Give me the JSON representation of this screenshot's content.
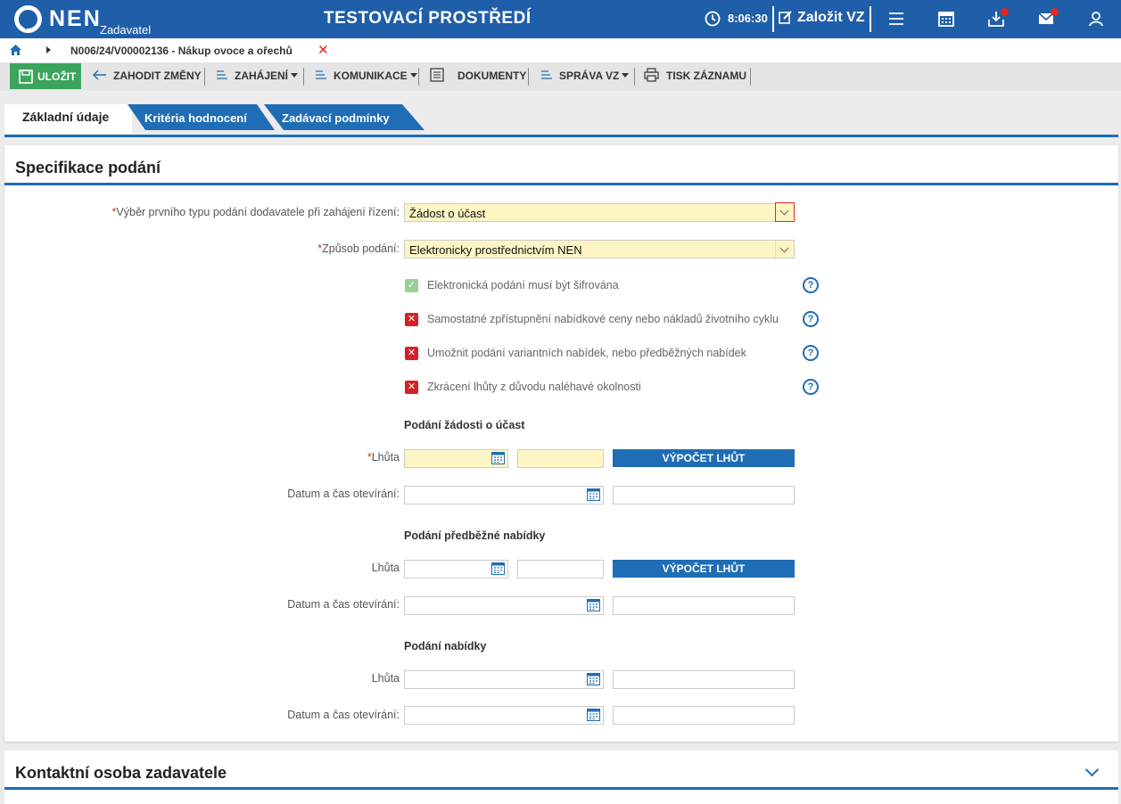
{
  "header": {
    "logo_text": "NEN",
    "logo_sub": "Zadavatel",
    "environment": "TESTOVACÍ PROSTŘEDÍ",
    "time": "8:06:30",
    "create_label": "Založit VZ"
  },
  "breadcrumb": {
    "text": "N006/24/V00002136 - Nákup ovoce a ořechů",
    "close": "✕"
  },
  "toolbar": {
    "save": "ULOŽIT",
    "discard": "ZAHODIT ZMĚNY",
    "start": "ZAHÁJENÍ",
    "communication": "KOMUNIKACE",
    "documents": "DOKUMENTY",
    "management": "SPRÁVA VZ",
    "print": "TISK ZÁZNAMU"
  },
  "tabs": {
    "basic": "Základní údaje",
    "criteria": "Kritéria hodnocení",
    "conditions": "Zadávací podmínky"
  },
  "section": {
    "title": "Specifikace podání",
    "first_type_label": "Výběr prvního typu podání dodavatele při zahájení řízení:",
    "first_type_value": "Žádost o účast",
    "method_label": "Způsob podání:",
    "method_value": "Elektronicky prostřednictvím NEN",
    "required_mark": "*",
    "checkboxes": [
      {
        "label": "Elektronická podání musí být šifrována",
        "checked": true
      },
      {
        "label": "Samostatné zpřístupnění nabídkové ceny nebo nákladů životního cyklu",
        "checked": false
      },
      {
        "label": "Umožnit podání variantních nabídek, nebo předběžných nabídek",
        "checked": false
      },
      {
        "label": "Zkrácení lhůty z důvodu naléhavé okolnosti",
        "checked": false
      }
    ],
    "help_mark": "?",
    "check_on": "✓",
    "check_off": "✕",
    "groups": [
      {
        "title": "Podání žádosti o účast",
        "deadline_label": "Lhůta",
        "opening_label": "Datum a čas otevírání:",
        "calc_button": "VÝPOČET LHŮT"
      },
      {
        "title": "Podání předběžné nabídky",
        "deadline_label": "Lhůta",
        "opening_label": "Datum a čas otevírání:",
        "calc_button": "VÝPOČET LHŮT"
      },
      {
        "title": "Podání nabídky",
        "deadline_label": "Lhůta",
        "opening_label": "Datum a čas otevírání:"
      }
    ]
  },
  "section2": {
    "title": "Kontaktní osoba zadavatele"
  }
}
